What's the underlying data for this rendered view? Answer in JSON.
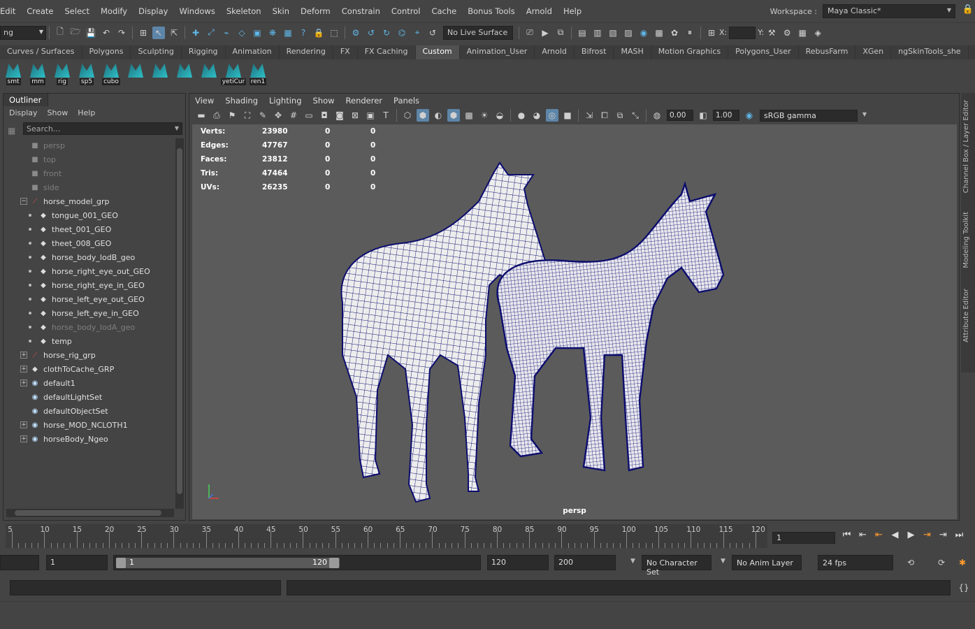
{
  "menubar": {
    "items": [
      "Edit",
      "Create",
      "Select",
      "Modify",
      "Display",
      "Windows",
      "Skeleton",
      "Skin",
      "Deform",
      "Constrain",
      "Control",
      "Cache",
      "Bonus Tools",
      "Arnold",
      "Help"
    ],
    "workspace_label": "Workspace :",
    "workspace_value": "Maya Classic*"
  },
  "statusline": {
    "menuset": "ng",
    "live_surface": "No Live Surface",
    "x_label": "X:",
    "y_label": "Y:"
  },
  "shelf": {
    "tabs": [
      "Curves / Surfaces",
      "Polygons",
      "Sculpting",
      "Rigging",
      "Animation",
      "Rendering",
      "FX",
      "FX Caching",
      "Custom",
      "Animation_User",
      "Arnold",
      "Bifrost",
      "MASH",
      "Motion Graphics",
      "Polygons_User",
      "RebusFarm",
      "XGen",
      "ngSkinTools_she"
    ],
    "active_tab": "Custom",
    "buttons": [
      "smt",
      "mm",
      "rig",
      "sp5",
      "cubo",
      "",
      "",
      "",
      "",
      "yetiCur",
      "ren1"
    ]
  },
  "outliner": {
    "title": "Outliner",
    "menus": [
      "Display",
      "Show",
      "Help"
    ],
    "search_placeholder": "Search...",
    "items": [
      {
        "label": "persp",
        "depth": 2,
        "icon": "camera",
        "dim": true,
        "expander": ""
      },
      {
        "label": "top",
        "depth": 2,
        "icon": "camera",
        "dim": true,
        "expander": ""
      },
      {
        "label": "front",
        "depth": 2,
        "icon": "camera",
        "dim": true,
        "expander": ""
      },
      {
        "label": "side",
        "depth": 2,
        "icon": "camera",
        "dim": true,
        "expander": ""
      },
      {
        "label": "horse_model_grp",
        "depth": 1,
        "icon": "group",
        "dim": false,
        "expander": "−"
      },
      {
        "label": "tongue_001_GEO",
        "depth": 3,
        "icon": "mesh",
        "dim": false,
        "expander": ""
      },
      {
        "label": "theet_001_GEO",
        "depth": 3,
        "icon": "mesh",
        "dim": false,
        "expander": ""
      },
      {
        "label": "theet_008_GEO",
        "depth": 3,
        "icon": "mesh",
        "dim": false,
        "expander": ""
      },
      {
        "label": "horse_body_lodB_geo",
        "depth": 3,
        "icon": "mesh",
        "dim": false,
        "expander": ""
      },
      {
        "label": "horse_right_eye_out_GEO",
        "depth": 3,
        "icon": "mesh",
        "dim": false,
        "expander": ""
      },
      {
        "label": "horse_right_eye_in_GEO",
        "depth": 3,
        "icon": "mesh",
        "dim": false,
        "expander": ""
      },
      {
        "label": "horse_left_eye_out_GEO",
        "depth": 3,
        "icon": "mesh",
        "dim": false,
        "expander": ""
      },
      {
        "label": "horse_left_eye_in_GEO",
        "depth": 3,
        "icon": "mesh",
        "dim": false,
        "expander": ""
      },
      {
        "label": "horse_body_lodA_geo",
        "depth": 3,
        "icon": "mesh",
        "dim": true,
        "expander": ""
      },
      {
        "label": "temp",
        "depth": 3,
        "icon": "mesh",
        "dim": false,
        "expander": ""
      },
      {
        "label": "horse_rig_grp",
        "depth": 1,
        "icon": "group",
        "dim": false,
        "expander": "+"
      },
      {
        "label": "clothToCache_GRP",
        "depth": 1,
        "icon": "mesh",
        "dim": false,
        "expander": "+"
      },
      {
        "label": "default1",
        "depth": 1,
        "icon": "set",
        "dim": false,
        "expander": "+"
      },
      {
        "label": "defaultLightSet",
        "depth": 1,
        "icon": "set",
        "dim": false,
        "expander": ""
      },
      {
        "label": "defaultObjectSet",
        "depth": 1,
        "icon": "set",
        "dim": false,
        "expander": ""
      },
      {
        "label": "horse_MOD_NCLOTH1",
        "depth": 1,
        "icon": "set",
        "dim": false,
        "expander": "+"
      },
      {
        "label": "horseBody_Ngeo",
        "depth": 1,
        "icon": "set",
        "dim": false,
        "expander": "+"
      }
    ]
  },
  "viewport": {
    "menus": [
      "View",
      "Shading",
      "Lighting",
      "Show",
      "Renderer",
      "Panels"
    ],
    "exposure": "0.00",
    "gamma": "1.00",
    "color_space": "sRGB gamma",
    "camera": "persp",
    "hud": [
      {
        "label": "Verts:",
        "v1": "23980",
        "v2": "0",
        "v3": "0"
      },
      {
        "label": "Edges:",
        "v1": "47767",
        "v2": "0",
        "v3": "0"
      },
      {
        "label": "Faces:",
        "v1": "23812",
        "v2": "0",
        "v3": "0"
      },
      {
        "label": "Tris:",
        "v1": "47464",
        "v2": "0",
        "v3": "0"
      },
      {
        "label": "UVs:",
        "v1": "26235",
        "v2": "0",
        "v3": "0"
      }
    ]
  },
  "right_tabs": [
    "Channel Box / Layer Editor",
    "Modeling Toolkit",
    "Attribute Editor"
  ],
  "timeline": {
    "ticks": [
      "5",
      "10",
      "15",
      "20",
      "25",
      "30",
      "35",
      "40",
      "45",
      "50",
      "55",
      "60",
      "65",
      "70",
      "75",
      "80",
      "85",
      "90",
      "95",
      "100",
      "105",
      "110",
      "115",
      "120"
    ],
    "current_frame": "1"
  },
  "range": {
    "start": "1",
    "slider_start": "1",
    "slider_end": "120",
    "end": "120",
    "anim_end": "200",
    "character_set": "No Character Set",
    "anim_layer": "No Anim Layer",
    "fps": "24 fps"
  },
  "colors": {
    "wire": "#0d0d6e",
    "mesh": "#f0f0f0",
    "viewport_bg": "#5b5b5b",
    "accent": "#5d85a8"
  }
}
